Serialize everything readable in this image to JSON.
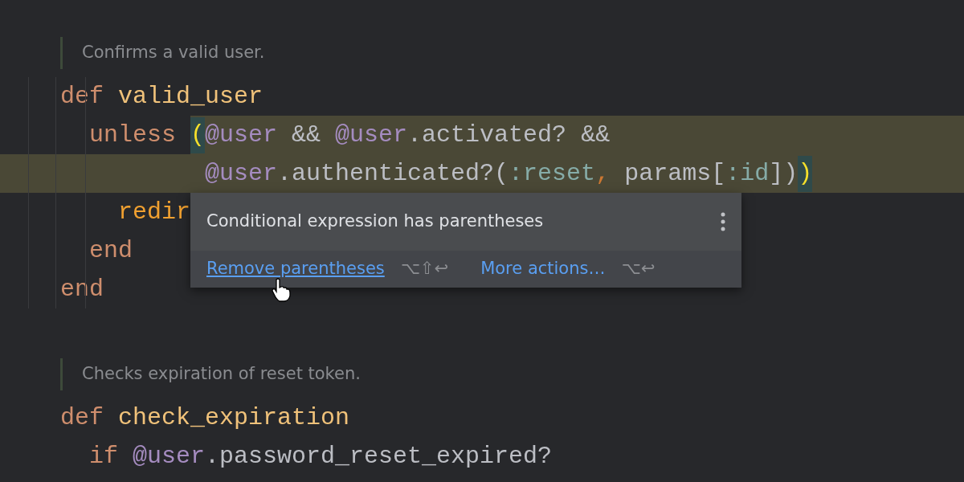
{
  "editor": {
    "lines": [
      {
        "kind": "doc",
        "text": "Confirms a valid user."
      },
      {
        "kind": "code",
        "highlighted": false,
        "tokens": [
          {
            "kind": "keyword",
            "text": "def "
          },
          {
            "kind": "name",
            "text": "valid_user"
          }
        ]
      },
      {
        "kind": "code",
        "highlighted": true,
        "tokens": [
          {
            "kind": "keyword",
            "text": "  unless "
          },
          {
            "kind": "brace",
            "text": "(",
            "matched": true
          },
          {
            "kind": "ivar",
            "text": "@user"
          },
          {
            "kind": "plain",
            "text": " && "
          },
          {
            "kind": "ivar",
            "text": "@user"
          },
          {
            "kind": "plain",
            "text": ".activated? &&"
          }
        ]
      },
      {
        "kind": "code",
        "highlighted": true,
        "tokens": [
          {
            "kind": "ivar",
            "text": "          @user"
          },
          {
            "kind": "plain",
            "text": ".authenticated?("
          },
          {
            "kind": "symbol",
            "text": ":reset"
          },
          {
            "kind": "comma",
            "text": ", "
          },
          {
            "kind": "plain",
            "text": "params["
          },
          {
            "kind": "symbol",
            "text": ":id"
          },
          {
            "kind": "plain",
            "text": "])"
          },
          {
            "kind": "brace",
            "text": ")",
            "matched": true
          }
        ]
      },
      {
        "kind": "code",
        "highlighted": false,
        "tokens": [
          {
            "kind": "call",
            "text": "    redir"
          }
        ]
      },
      {
        "kind": "code",
        "highlighted": false,
        "tokens": [
          {
            "kind": "keyword",
            "text": "  end"
          }
        ]
      },
      {
        "kind": "code",
        "highlighted": false,
        "tokens": [
          {
            "kind": "keyword",
            "text": "end"
          }
        ]
      },
      {
        "kind": "blank"
      },
      {
        "kind": "doc",
        "text": "Checks expiration of reset token."
      },
      {
        "kind": "code",
        "highlighted": false,
        "tokens": [
          {
            "kind": "keyword",
            "text": "def "
          },
          {
            "kind": "name",
            "text": "check_expiration"
          }
        ]
      },
      {
        "kind": "code",
        "highlighted": false,
        "tokens": [
          {
            "kind": "keyword",
            "text": "  if "
          },
          {
            "kind": "ivar",
            "text": "@user"
          },
          {
            "kind": "plain",
            "text": ".password_reset_expired?"
          }
        ]
      }
    ]
  },
  "popup": {
    "message": "Conditional expression has parentheses",
    "actions": [
      {
        "label": "Remove parentheses",
        "shortcut": "⌥⇧↩",
        "hovered": true
      },
      {
        "label": "More actions…",
        "shortcut": "⌥↩",
        "hovered": false
      }
    ]
  }
}
